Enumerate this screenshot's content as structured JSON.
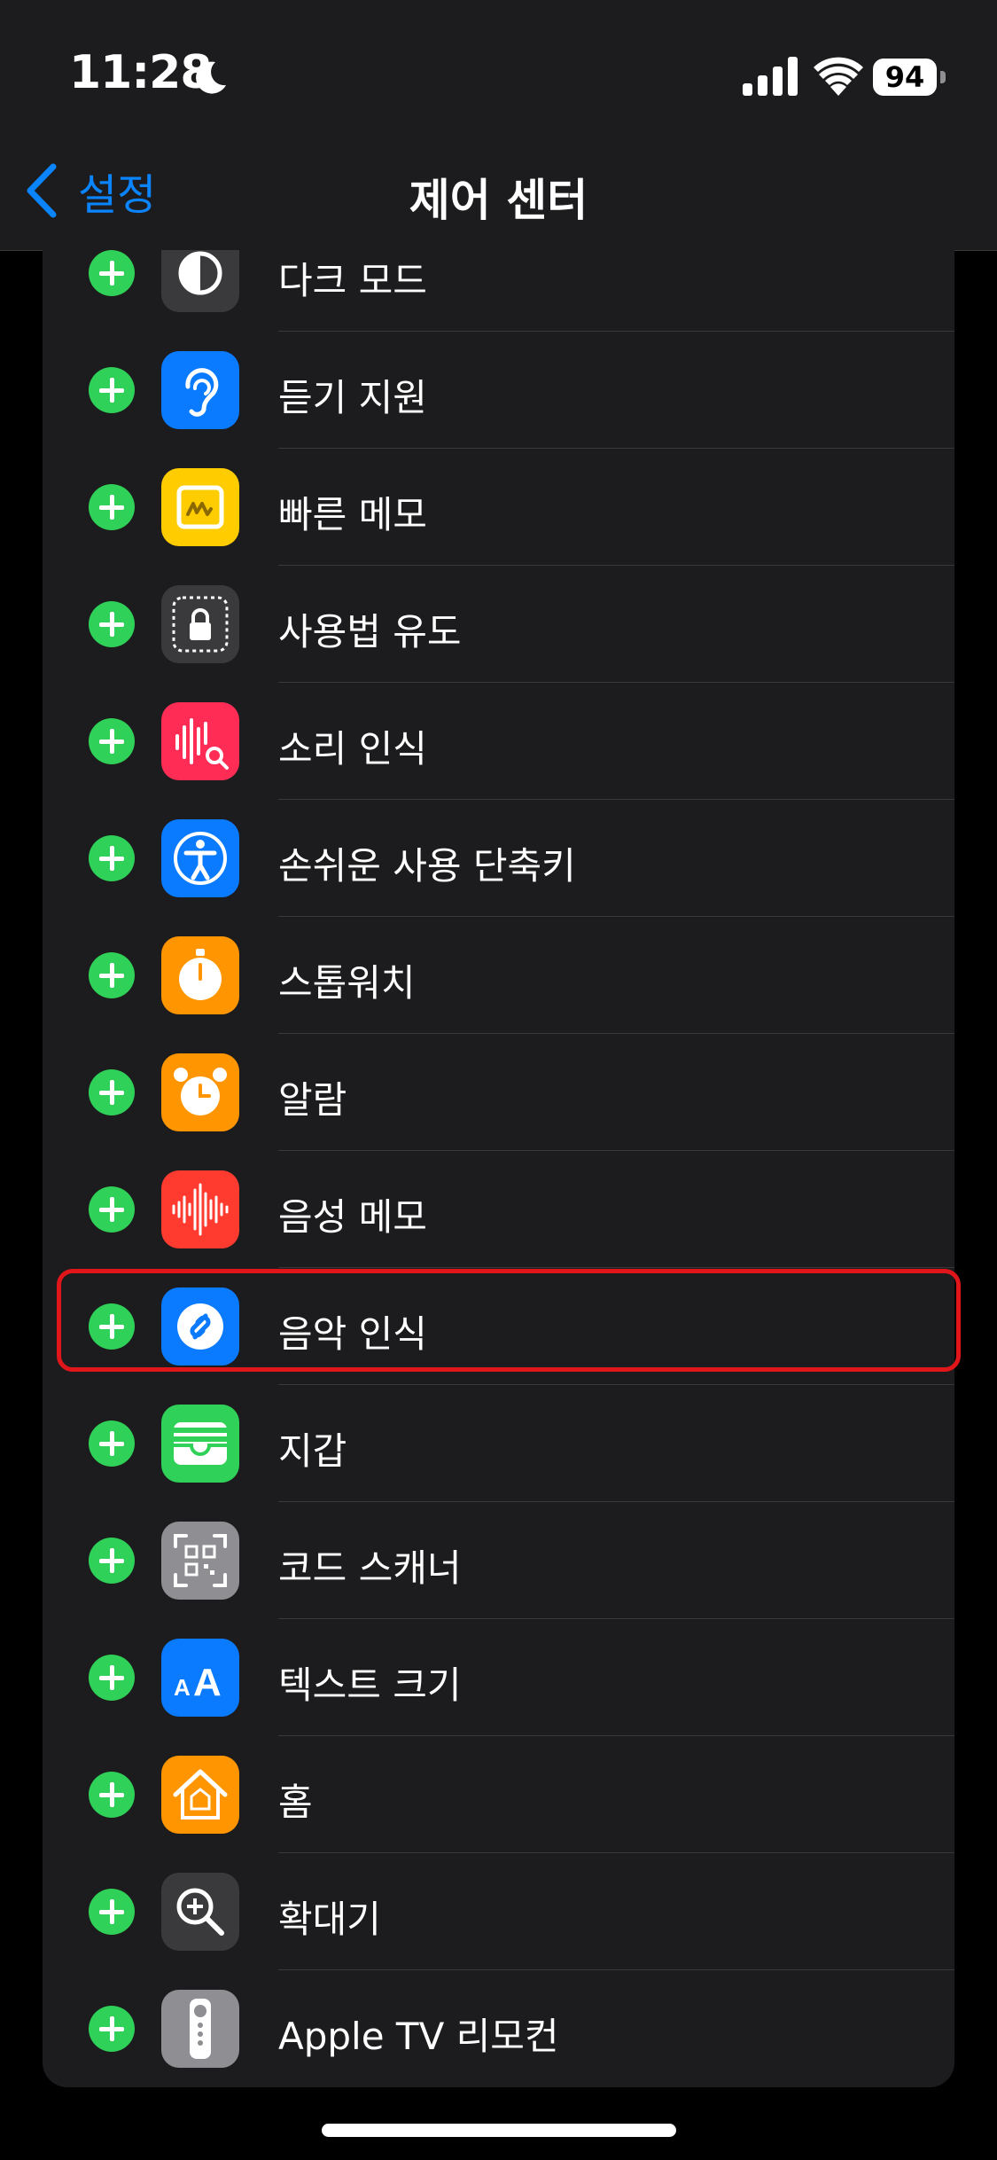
{
  "status_bar": {
    "time": "11:28",
    "battery": "94"
  },
  "nav": {
    "back_label": "설정",
    "title": "제어 센터"
  },
  "colors": {
    "accent": "#0a84ff",
    "add": "#30d158",
    "highlight": "#e0161b"
  },
  "items": [
    {
      "label": "다크 모드",
      "icon": "dark-mode-icon"
    },
    {
      "label": "듣기 지원",
      "icon": "hearing-icon"
    },
    {
      "label": "빠른 메모",
      "icon": "quick-note-icon"
    },
    {
      "label": "사용법 유도",
      "icon": "guided-access-icon"
    },
    {
      "label": "소리 인식",
      "icon": "sound-recognition-icon"
    },
    {
      "label": "손쉬운 사용 단축키",
      "icon": "accessibility-shortcut-icon"
    },
    {
      "label": "스톱워치",
      "icon": "stopwatch-icon"
    },
    {
      "label": "알람",
      "icon": "alarm-icon"
    },
    {
      "label": "음성 메모",
      "icon": "voice-memo-icon"
    },
    {
      "label": "음악 인식",
      "icon": "music-recognition-icon",
      "highlighted": true
    },
    {
      "label": "지갑",
      "icon": "wallet-icon"
    },
    {
      "label": "코드 스캐너",
      "icon": "code-scanner-icon"
    },
    {
      "label": "텍스트 크기",
      "icon": "text-size-icon",
      "glyph": "AA"
    },
    {
      "label": "홈",
      "icon": "home-icon"
    },
    {
      "label": "확대기",
      "icon": "magnifier-icon"
    },
    {
      "label": "Apple TV 리모컨",
      "icon": "apple-tv-remote-icon"
    }
  ]
}
